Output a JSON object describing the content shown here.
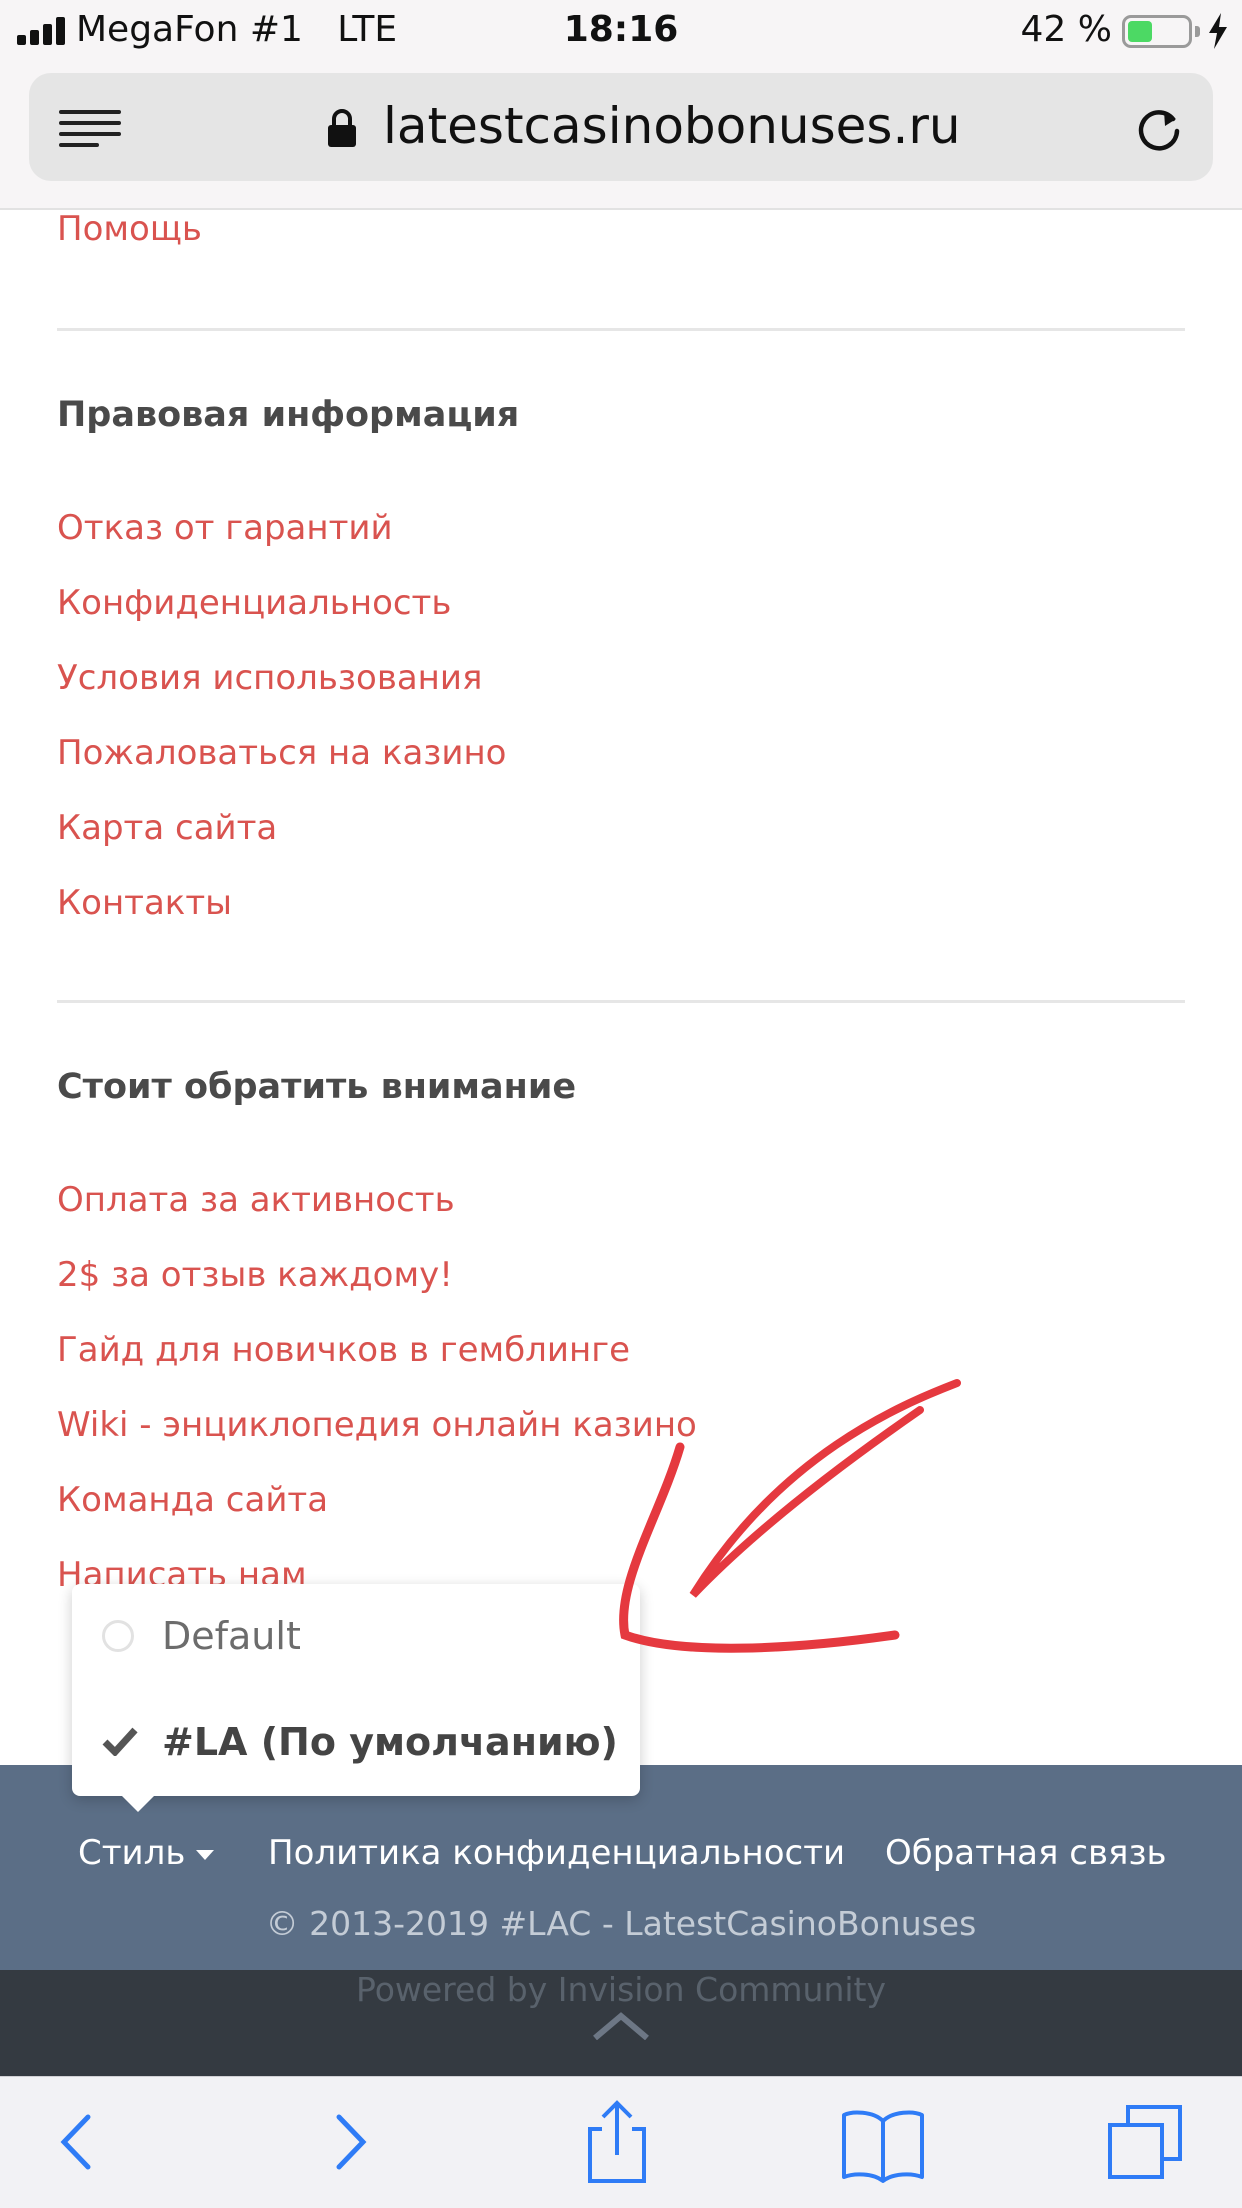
{
  "status_bar": {
    "carrier": "MegaFon #1",
    "network": "LTE",
    "time": "18:16",
    "battery_percent_text": "42 %",
    "battery_level": 0.42,
    "charging_icon": "bolt-icon"
  },
  "browser": {
    "url": "latestcasinobonuses.ru",
    "menu_icon": "menu-icon",
    "lock_icon": "lock-icon",
    "reload_icon": "reload-icon"
  },
  "top_links": [
    "Помощь"
  ],
  "sections": [
    {
      "heading": "Правовая информация",
      "links": [
        "Отказ от гарантий",
        "Конфиденциальность",
        "Условия использования",
        "Пожаловаться на казино",
        "Карта сайта",
        "Контакты"
      ]
    },
    {
      "heading": "Стоит обратить внимание",
      "links": [
        "Оплата за активность",
        "2$ за отзыв каждому!",
        "Гайд для новичков в гемблинге",
        "Wiki - энциклопедия онлайн казино",
        "Команда сайта",
        "Написать нам"
      ]
    }
  ],
  "style_dropdown": {
    "options": [
      {
        "label": "Default",
        "selected": false
      },
      {
        "label": "#LA (По умолчанию)",
        "selected": true
      }
    ]
  },
  "footer": {
    "style_label": "Стиль",
    "privacy_label": "Политика конфиденциальности",
    "feedback_label": "Обратная связь",
    "copyright": "© 2013-2019 #LAC - LatestCasinoBonuses",
    "powered": "Powered by Invision Community"
  },
  "toolbar": {
    "icons": [
      "back-icon",
      "forward-icon",
      "share-icon",
      "bookmarks-icon",
      "tabs-icon"
    ]
  },
  "colors": {
    "link": "#d9534f",
    "heading": "#4a4a4a",
    "footer_bg": "#5b6e86",
    "footer_strip": "#343a41",
    "toolbar_icon": "#2f7cf6",
    "annotation": "#e5393f"
  }
}
